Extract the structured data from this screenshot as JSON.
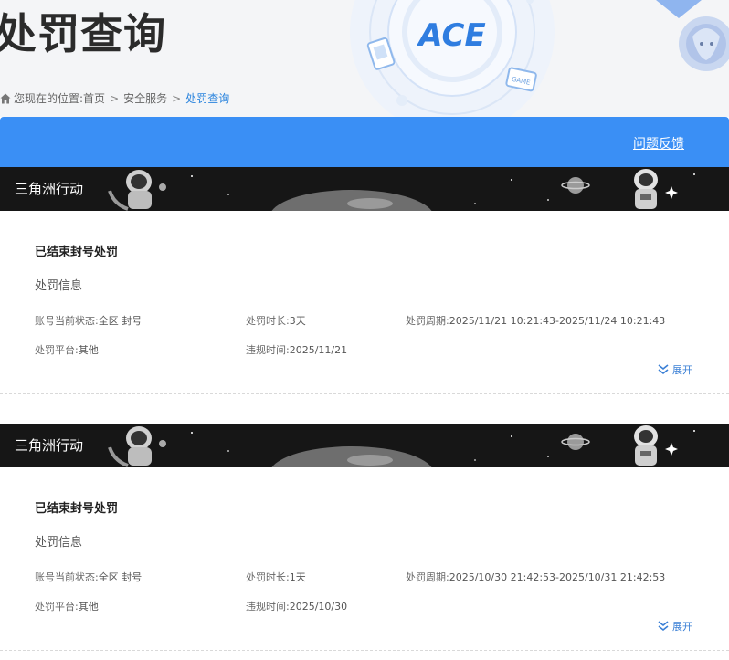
{
  "page": {
    "title": "处罚查询",
    "header_logo_text": "ACE",
    "header_badges": [
      "GAME"
    ]
  },
  "breadcrumb": {
    "prefix": "您现在的位置:",
    "items": [
      {
        "label": "首页",
        "current": false
      },
      {
        "label": "安全服务",
        "current": false
      },
      {
        "label": "处罚查询",
        "current": true
      }
    ],
    "separator": ">"
  },
  "action_bar": {
    "feedback_label": "问题反馈",
    "color": "#3a8ff5"
  },
  "records": [
    {
      "game": "三角洲行动",
      "status_title": "已结束封号处罚",
      "section_label": "处罚信息",
      "account_status_label": "账号当前状态:",
      "account_status_value": "全区 封号",
      "duration_label": "处罚时长:",
      "duration_value": "3天",
      "period_label": "处罚周期:",
      "period_value": "2025/11/21 10:21:43-2025/11/24 10:21:43",
      "platform_label": "处罚平台:",
      "platform_value": "其他",
      "violation_time_label": "违规时间:",
      "violation_time_value": "2025/11/21",
      "expand_label": "展开"
    },
    {
      "game": "三角洲行动",
      "status_title": "已结束封号处罚",
      "section_label": "处罚信息",
      "account_status_label": "账号当前状态:",
      "account_status_value": "全区 封号",
      "duration_label": "处罚时长:",
      "duration_value": "1天",
      "period_label": "处罚周期:",
      "period_value": "2025/10/30 21:42:53-2025/10/31 21:42:53",
      "platform_label": "处罚平台:",
      "platform_value": "其他",
      "violation_time_label": "违规时间:",
      "violation_time_value": "2025/10/30",
      "expand_label": "展开"
    }
  ],
  "colors": {
    "accent": "#3a8ff5",
    "link": "#2e86de",
    "banner_bg": "#161616"
  }
}
